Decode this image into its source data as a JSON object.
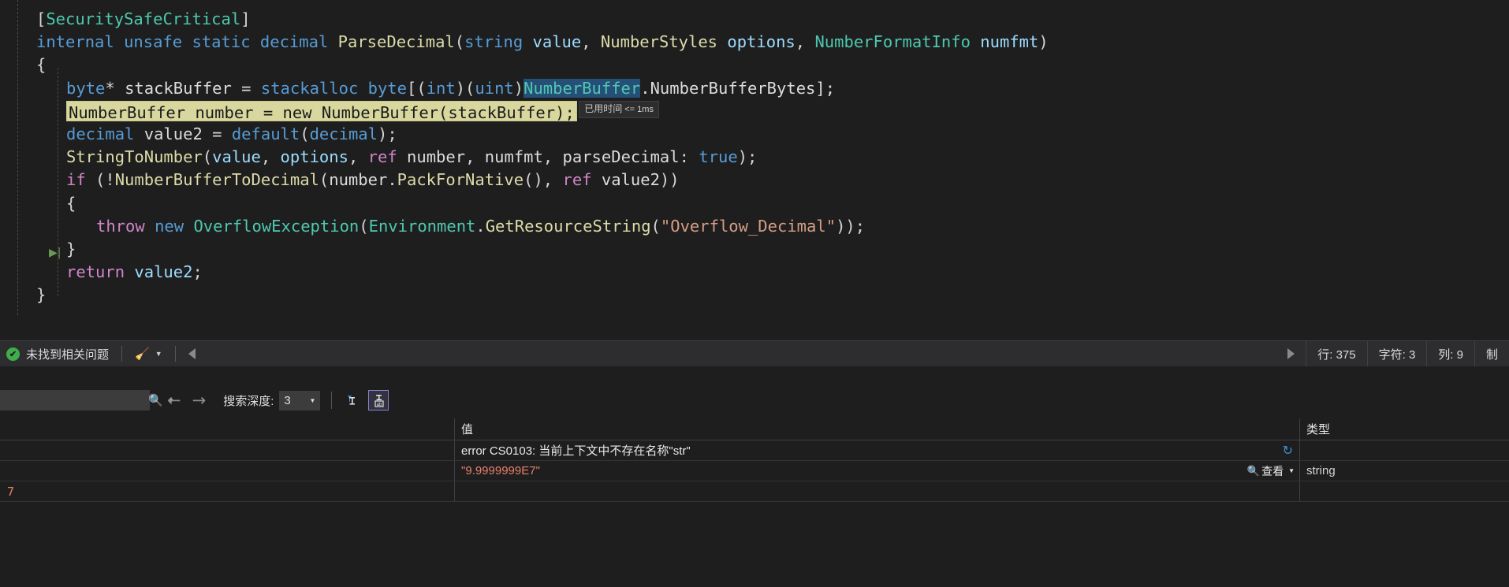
{
  "editor": {
    "language": "csharp",
    "colors": {
      "background": "#1e1e1e",
      "keyword": "#569cd6",
      "type": "#4ec9b0",
      "method": "#dcdcaa",
      "identifier": "#9cdcfe",
      "control": "#d085c8",
      "string": "#d69d85",
      "selection": "#264f78",
      "current_statement": "#d7d79e"
    },
    "lines": [
      {
        "id": "l1",
        "indent": 1,
        "tokens": [
          {
            "t": "[",
            "c": "p"
          },
          {
            "t": "SecuritySafeCritical",
            "c": "ty"
          },
          {
            "t": "]",
            "c": "p"
          }
        ]
      },
      {
        "id": "l2",
        "indent": 1,
        "tokens": [
          {
            "t": "internal",
            "c": "k"
          },
          {
            "t": " ",
            "c": "p"
          },
          {
            "t": "unsafe",
            "c": "k"
          },
          {
            "t": " ",
            "c": "p"
          },
          {
            "t": "static",
            "c": "k"
          },
          {
            "t": " ",
            "c": "p"
          },
          {
            "t": "decimal",
            "c": "k"
          },
          {
            "t": " ",
            "c": "p"
          },
          {
            "t": "ParseDecimal",
            "c": "m"
          },
          {
            "t": "(",
            "c": "p"
          },
          {
            "t": "string",
            "c": "k"
          },
          {
            "t": " ",
            "c": "p"
          },
          {
            "t": "value",
            "c": "id"
          },
          {
            "t": ", ",
            "c": "p"
          },
          {
            "t": "NumberStyles",
            "c": "m"
          },
          {
            "t": " ",
            "c": "p"
          },
          {
            "t": "options",
            "c": "id"
          },
          {
            "t": ", ",
            "c": "p"
          },
          {
            "t": "NumberFormatInfo",
            "c": "ty"
          },
          {
            "t": " ",
            "c": "p"
          },
          {
            "t": "numfmt",
            "c": "id"
          },
          {
            "t": ")",
            "c": "p"
          }
        ]
      },
      {
        "id": "l3",
        "indent": 1,
        "tokens": [
          {
            "t": "{",
            "c": "p"
          }
        ]
      },
      {
        "id": "l4",
        "indent": 2,
        "tokens": [
          {
            "t": "byte",
            "c": "k"
          },
          {
            "t": "* ",
            "c": "p"
          },
          {
            "t": "stackBuffer",
            "c": "w"
          },
          {
            "t": " = ",
            "c": "p"
          },
          {
            "t": "stackalloc",
            "c": "k"
          },
          {
            "t": " ",
            "c": "p"
          },
          {
            "t": "byte",
            "c": "k"
          },
          {
            "t": "[(",
            "c": "p"
          },
          {
            "t": "int",
            "c": "k"
          },
          {
            "t": ")(",
            "c": "p"
          },
          {
            "t": "uint",
            "c": "k"
          },
          {
            "t": ")",
            "c": "p"
          },
          {
            "t": "NumberBuffer",
            "c": "sel-token"
          },
          {
            "t": ".NumberBufferBytes];",
            "c": "w"
          }
        ]
      },
      {
        "id": "l5",
        "indent": 2,
        "highlight": true,
        "highlight_text": "NumberBuffer number = new NumberBuffer(stackBuffer);",
        "tooltip": "已用时间",
        "tooltip_value": "<= 1ms",
        "tokens": []
      },
      {
        "id": "l6",
        "indent": 2,
        "tokens": [
          {
            "t": "decimal",
            "c": "k"
          },
          {
            "t": " ",
            "c": "p"
          },
          {
            "t": "value2",
            "c": "w"
          },
          {
            "t": " = ",
            "c": "p"
          },
          {
            "t": "default",
            "c": "k"
          },
          {
            "t": "(",
            "c": "p"
          },
          {
            "t": "decimal",
            "c": "k"
          },
          {
            "t": ");",
            "c": "p"
          }
        ]
      },
      {
        "id": "l7",
        "indent": 2,
        "tokens": [
          {
            "t": "StringToNumber",
            "c": "m"
          },
          {
            "t": "(",
            "c": "p"
          },
          {
            "t": "value",
            "c": "id"
          },
          {
            "t": ", ",
            "c": "p"
          },
          {
            "t": "options",
            "c": "id"
          },
          {
            "t": ", ",
            "c": "p"
          },
          {
            "t": "ref",
            "c": "ctl"
          },
          {
            "t": " ",
            "c": "p"
          },
          {
            "t": "number",
            "c": "w"
          },
          {
            "t": ", ",
            "c": "p"
          },
          {
            "t": "numfmt",
            "c": "w"
          },
          {
            "t": ", ",
            "c": "p"
          },
          {
            "t": "parseDecimal",
            "c": "w"
          },
          {
            "t": ": ",
            "c": "p"
          },
          {
            "t": "true",
            "c": "k"
          },
          {
            "t": ");",
            "c": "p"
          }
        ]
      },
      {
        "id": "l8",
        "indent": 2,
        "tokens": [
          {
            "t": "if",
            "c": "ctl"
          },
          {
            "t": " (!",
            "c": "p"
          },
          {
            "t": "NumberBufferToDecimal",
            "c": "m"
          },
          {
            "t": "(",
            "c": "p"
          },
          {
            "t": "number",
            "c": "w"
          },
          {
            "t": ".",
            "c": "p"
          },
          {
            "t": "PackForNative",
            "c": "m"
          },
          {
            "t": "(), ",
            "c": "p"
          },
          {
            "t": "ref",
            "c": "ctl"
          },
          {
            "t": " ",
            "c": "p"
          },
          {
            "t": "value2",
            "c": "w"
          },
          {
            "t": "))",
            "c": "p"
          }
        ]
      },
      {
        "id": "l9",
        "indent": 2,
        "tokens": [
          {
            "t": "{",
            "c": "p"
          }
        ]
      },
      {
        "id": "l10",
        "indent": 3,
        "tokens": [
          {
            "t": "throw",
            "c": "ctl"
          },
          {
            "t": " ",
            "c": "p"
          },
          {
            "t": "new",
            "c": "k"
          },
          {
            "t": " ",
            "c": "p"
          },
          {
            "t": "OverflowException",
            "c": "ty"
          },
          {
            "t": "(",
            "c": "p"
          },
          {
            "t": "Environment",
            "c": "ty"
          },
          {
            "t": ".",
            "c": "p"
          },
          {
            "t": "GetResourceString",
            "c": "m"
          },
          {
            "t": "(",
            "c": "p"
          },
          {
            "t": "\"Overflow_Decimal\"",
            "c": "str"
          },
          {
            "t": "));",
            "c": "p"
          }
        ]
      },
      {
        "id": "l11",
        "indent": 2,
        "fold": true,
        "tokens": [
          {
            "t": "}",
            "c": "p"
          }
        ]
      },
      {
        "id": "l12",
        "indent": 2,
        "tokens": [
          {
            "t": "return",
            "c": "ctl"
          },
          {
            "t": " ",
            "c": "p"
          },
          {
            "t": "value2",
            "c": "id"
          },
          {
            "t": ";",
            "c": "p"
          }
        ]
      },
      {
        "id": "l13",
        "indent": 1,
        "tokens": [
          {
            "t": "}",
            "c": "p"
          }
        ]
      }
    ]
  },
  "statusbar": {
    "status_text": "未找到相关问题",
    "ok_glyph": "✔",
    "broom_glyph": "🧹",
    "caret_glyph": "▼",
    "line_label": "行: 375",
    "char_label": "字符: 3",
    "col_label": "列: 9",
    "tab_label": "制"
  },
  "watch": {
    "search_placeholder": "",
    "search_value": "",
    "search_icon": "🔍",
    "back_arrow": "←",
    "forward_arrow": "→",
    "depth_label": "搜索深度:",
    "depth_value": "3",
    "depth_caret": "▼",
    "columns": [
      {
        "key": "name",
        "label": ""
      },
      {
        "key": "value",
        "label": "值"
      },
      {
        "key": "type",
        "label": "类型"
      }
    ],
    "rows": [
      {
        "name": "",
        "value": "error CS0103: 当前上下文中不存在名称\"str\"",
        "value_style": "error",
        "type": "",
        "refresh_icon": "↻"
      },
      {
        "name": "",
        "value": "\"9.9999999E7\"",
        "value_style": "string",
        "type": "string",
        "view_label": "查看",
        "view_icon": "🔍",
        "view_caret": "▼"
      }
    ],
    "partial_row_glyph": "7"
  }
}
